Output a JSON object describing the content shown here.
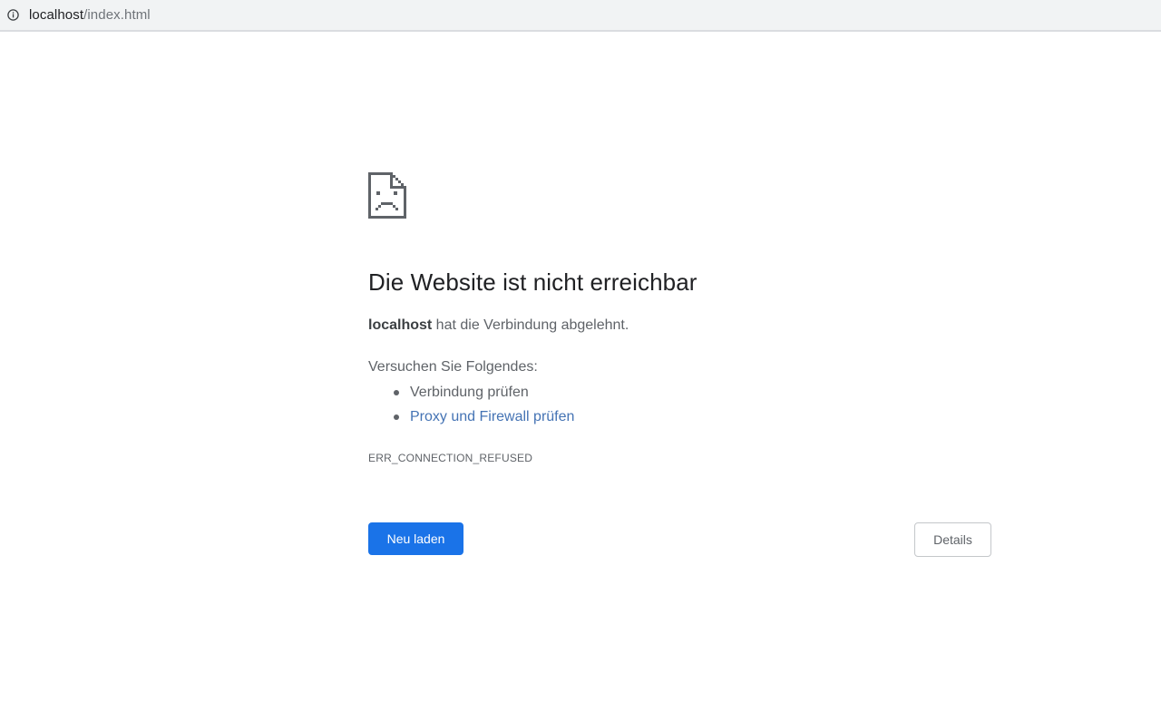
{
  "address_bar": {
    "icon": "info-icon",
    "url_host": "localhost",
    "url_path": "/index.html"
  },
  "error": {
    "icon": "sad-page-icon",
    "title": "Die Website ist nicht erreichbar",
    "host": "localhost",
    "message_suffix": " hat die Verbindung abgelehnt.",
    "try_label": "Versuchen Sie Folgendes:",
    "suggestions": [
      {
        "label": "Verbindung prüfen"
      },
      {
        "label": "Proxy und Firewall prüfen"
      }
    ],
    "code": "ERR_CONNECTION_REFUSED"
  },
  "buttons": {
    "reload_label": "Neu laden",
    "details_label": "Details"
  },
  "colors": {
    "primary_button": "#1a73e8",
    "link": "#4473b4",
    "heading": "#202124",
    "body_text": "#5f6368"
  }
}
